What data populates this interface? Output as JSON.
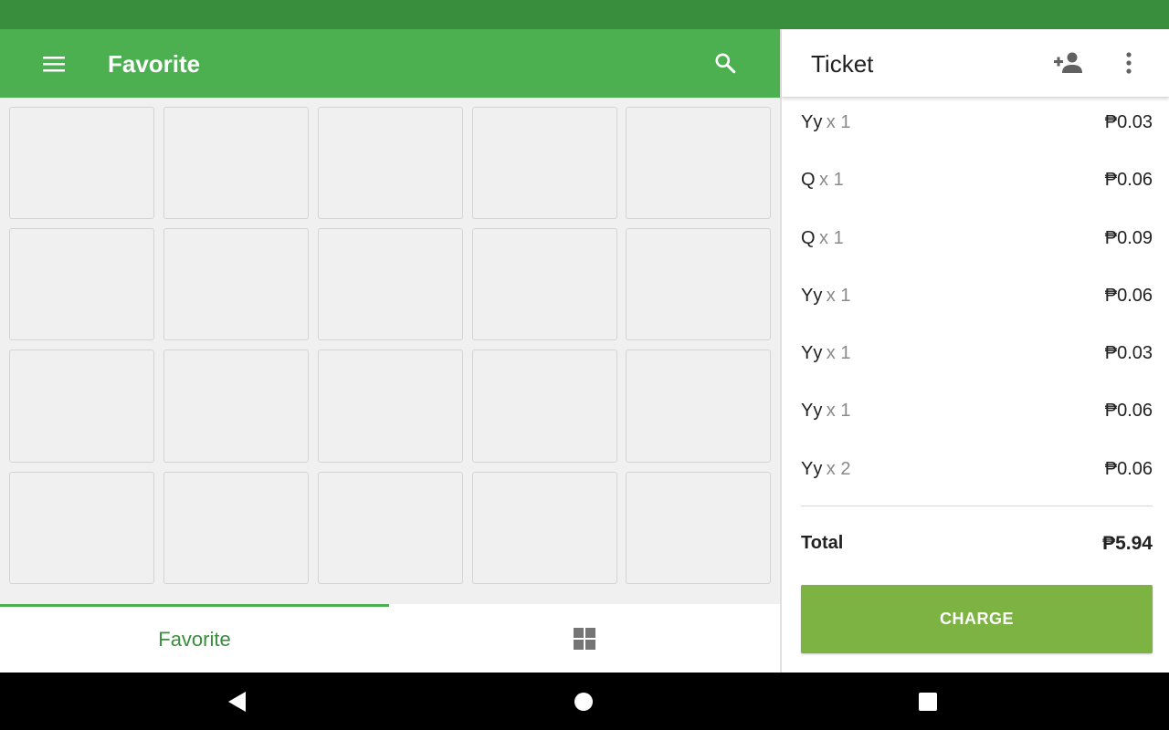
{
  "colors": {
    "status_bar": "#388e3c",
    "app_bar": "#4caf50",
    "accent_text": "#388e3c",
    "charge_button": "#7cb342"
  },
  "app_bar": {
    "title": "Favorite",
    "menu_icon": "menu-icon",
    "search_icon": "search-icon"
  },
  "grid": {
    "rows": 4,
    "columns": 5,
    "tiles_empty": true
  },
  "bottom_tabs": {
    "favorite_label": "Favorite",
    "grid_icon": "grid-view-icon",
    "selected": "Favorite"
  },
  "ticket": {
    "title": "Ticket",
    "add_customer_icon": "add-customer-icon",
    "more_icon": "more-vert-icon",
    "items": [
      {
        "name": "Yy",
        "qty": "x 1",
        "price": "₱0.03"
      },
      {
        "name": "Q",
        "qty": "x 1",
        "price": "₱0.06"
      },
      {
        "name": "Q",
        "qty": "x 1",
        "price": "₱0.09"
      },
      {
        "name": "Yy",
        "qty": "x 1",
        "price": "₱0.06"
      },
      {
        "name": "Yy",
        "qty": "x 1",
        "price": "₱0.03"
      },
      {
        "name": "Yy",
        "qty": "x 1",
        "price": "₱0.06"
      },
      {
        "name": "Yy",
        "qty": "x 2",
        "price": "₱0.06"
      }
    ],
    "total_label": "Total",
    "total_value": "₱5.94",
    "charge_label": "CHARGE"
  },
  "nav_bar": {
    "back_icon": "back-icon",
    "home_icon": "home-icon",
    "recents_icon": "recents-icon"
  }
}
